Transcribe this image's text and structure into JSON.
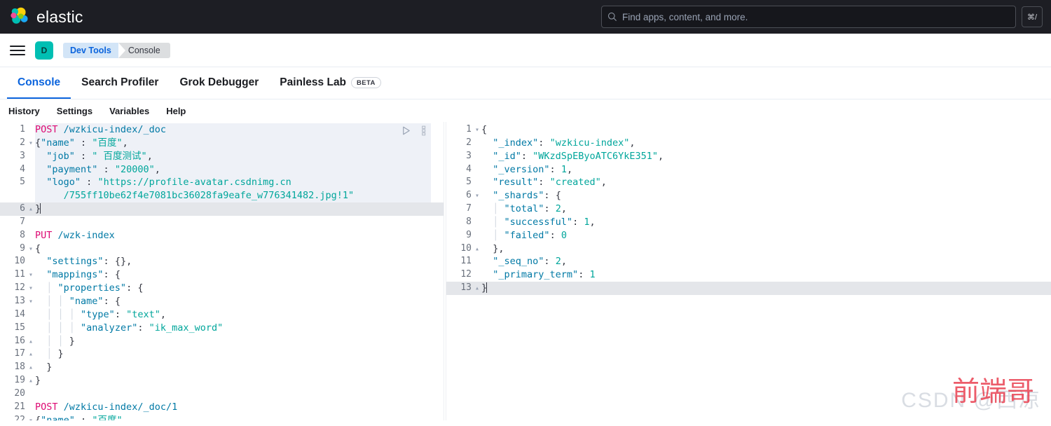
{
  "header": {
    "brand": "elastic",
    "logo_icon": "elastic-logo-icon",
    "search": {
      "placeholder": "Find apps, content, and more.",
      "icon": "search-icon",
      "shortcut": "⌘/"
    }
  },
  "breadcrumb": {
    "menu_icon": "hamburger-menu-icon",
    "space_initial": "D",
    "items": [
      {
        "label": "Dev Tools"
      },
      {
        "label": "Console"
      }
    ]
  },
  "app_tabs": [
    {
      "label": "Console",
      "active": true,
      "badge": ""
    },
    {
      "label": "Search Profiler",
      "active": false,
      "badge": ""
    },
    {
      "label": "Grok Debugger",
      "active": false,
      "badge": ""
    },
    {
      "label": "Painless Lab",
      "active": false,
      "badge": "BETA"
    }
  ],
  "console_submenu": [
    {
      "label": "History"
    },
    {
      "label": "Settings"
    },
    {
      "label": "Variables"
    },
    {
      "label": "Help"
    }
  ],
  "editor_actions": {
    "run_icon": "play-run-icon",
    "wrench_icon": "wrench-menu-icon"
  },
  "editor": {
    "lines": [
      {
        "n": "1",
        "fold": "",
        "tokens": [
          {
            "t": "POST",
            "c": "tk-method"
          },
          {
            "t": " ",
            "c": "tk-plain"
          },
          {
            "t": "/wzkicu-index/_doc",
            "c": "tk-url"
          }
        ]
      },
      {
        "n": "2",
        "fold": "▾",
        "tokens": [
          {
            "t": "{",
            "c": "tk-punct"
          },
          {
            "t": "\"name\"",
            "c": "tk-key"
          },
          {
            "t": " : ",
            "c": "tk-punct"
          },
          {
            "t": "\"百度\"",
            "c": "tk-string"
          },
          {
            "t": ",",
            "c": "tk-punct"
          }
        ]
      },
      {
        "n": "3",
        "fold": "",
        "tokens": [
          {
            "t": "  ",
            "c": "tk-plain"
          },
          {
            "t": "\"job\"",
            "c": "tk-key"
          },
          {
            "t": " : ",
            "c": "tk-punct"
          },
          {
            "t": "\" 百度测试\"",
            "c": "tk-string"
          },
          {
            "t": ",",
            "c": "tk-punct"
          }
        ]
      },
      {
        "n": "4",
        "fold": "",
        "tokens": [
          {
            "t": "  ",
            "c": "tk-plain"
          },
          {
            "t": "\"payment\"",
            "c": "tk-key"
          },
          {
            "t": " : ",
            "c": "tk-punct"
          },
          {
            "t": "\"20000\"",
            "c": "tk-string"
          },
          {
            "t": ",",
            "c": "tk-punct"
          }
        ]
      },
      {
        "n": "5",
        "fold": "",
        "tokens": [
          {
            "t": "  ",
            "c": "tk-plain"
          },
          {
            "t": "\"logo\"",
            "c": "tk-key"
          },
          {
            "t": " : ",
            "c": "tk-punct"
          },
          {
            "t": "\"https://profile-avatar.csdnimg.cn",
            "c": "tk-string"
          }
        ]
      },
      {
        "n": "",
        "fold": "",
        "tokens": [
          {
            "t": "     /755ff10be62f4e7081bc36028fa9eafe_w776341482.jpg!1\"",
            "c": "tk-string"
          }
        ]
      },
      {
        "n": "6",
        "fold": "▴",
        "caret": true,
        "tokens": [
          {
            "t": "}",
            "c": "tk-punct"
          }
        ]
      },
      {
        "n": "7",
        "fold": "",
        "tokens": []
      },
      {
        "n": "8",
        "fold": "",
        "tokens": [
          {
            "t": "PUT",
            "c": "tk-method"
          },
          {
            "t": " ",
            "c": "tk-plain"
          },
          {
            "t": "/wzk-index",
            "c": "tk-url"
          }
        ]
      },
      {
        "n": "9",
        "fold": "▾",
        "tokens": [
          {
            "t": "{",
            "c": "tk-punct"
          }
        ]
      },
      {
        "n": "10",
        "fold": "",
        "tokens": [
          {
            "t": "  ",
            "c": "tk-plain"
          },
          {
            "t": "\"settings\"",
            "c": "tk-key"
          },
          {
            "t": ": ",
            "c": "tk-punct"
          },
          {
            "t": "{},",
            "c": "tk-punct"
          }
        ]
      },
      {
        "n": "11",
        "fold": "▾",
        "tokens": [
          {
            "t": "  ",
            "c": "tk-plain"
          },
          {
            "t": "\"mappings\"",
            "c": "tk-key"
          },
          {
            "t": ": ",
            "c": "tk-punct"
          },
          {
            "t": "{",
            "c": "tk-punct"
          }
        ]
      },
      {
        "n": "12",
        "fold": "▾",
        "tokens": [
          {
            "t": "  ",
            "c": "tk-plain"
          },
          {
            "t": "│ ",
            "c": "tk-guide"
          },
          {
            "t": "\"properties\"",
            "c": "tk-key"
          },
          {
            "t": ": ",
            "c": "tk-punct"
          },
          {
            "t": "{",
            "c": "tk-punct"
          }
        ]
      },
      {
        "n": "13",
        "fold": "▾",
        "tokens": [
          {
            "t": "  ",
            "c": "tk-plain"
          },
          {
            "t": "│ │ ",
            "c": "tk-guide"
          },
          {
            "t": "\"name\"",
            "c": "tk-key"
          },
          {
            "t": ": ",
            "c": "tk-punct"
          },
          {
            "t": "{",
            "c": "tk-punct"
          }
        ]
      },
      {
        "n": "14",
        "fold": "",
        "tokens": [
          {
            "t": "  ",
            "c": "tk-plain"
          },
          {
            "t": "│ │ │ ",
            "c": "tk-guide"
          },
          {
            "t": "\"type\"",
            "c": "tk-key"
          },
          {
            "t": ": ",
            "c": "tk-punct"
          },
          {
            "t": "\"text\"",
            "c": "tk-string"
          },
          {
            "t": ",",
            "c": "tk-punct"
          }
        ]
      },
      {
        "n": "15",
        "fold": "",
        "tokens": [
          {
            "t": "  ",
            "c": "tk-plain"
          },
          {
            "t": "│ │ │ ",
            "c": "tk-guide"
          },
          {
            "t": "\"analyzer\"",
            "c": "tk-key"
          },
          {
            "t": ": ",
            "c": "tk-punct"
          },
          {
            "t": "\"ik_max_word\"",
            "c": "tk-string"
          }
        ]
      },
      {
        "n": "16",
        "fold": "▴",
        "tokens": [
          {
            "t": "  ",
            "c": "tk-plain"
          },
          {
            "t": "│ │ ",
            "c": "tk-guide"
          },
          {
            "t": "}",
            "c": "tk-punct"
          }
        ]
      },
      {
        "n": "17",
        "fold": "▴",
        "tokens": [
          {
            "t": "  ",
            "c": "tk-plain"
          },
          {
            "t": "│ ",
            "c": "tk-guide"
          },
          {
            "t": "}",
            "c": "tk-punct"
          }
        ]
      },
      {
        "n": "18",
        "fold": "▴",
        "tokens": [
          {
            "t": "  ",
            "c": "tk-plain"
          },
          {
            "t": "}",
            "c": "tk-punct"
          }
        ]
      },
      {
        "n": "19",
        "fold": "▴",
        "tokens": [
          {
            "t": "}",
            "c": "tk-punct"
          }
        ]
      },
      {
        "n": "20",
        "fold": "",
        "tokens": []
      },
      {
        "n": "21",
        "fold": "",
        "tokens": [
          {
            "t": "POST",
            "c": "tk-method"
          },
          {
            "t": " ",
            "c": "tk-plain"
          },
          {
            "t": "/wzkicu-index/_doc/1",
            "c": "tk-url"
          }
        ]
      },
      {
        "n": "22",
        "fold": "▾",
        "tokens": [
          {
            "t": "{",
            "c": "tk-punct"
          },
          {
            "t": "\"name\"",
            "c": "tk-key"
          },
          {
            "t": " : ",
            "c": "tk-punct"
          },
          {
            "t": "\"百度\"",
            "c": "tk-string"
          }
        ]
      }
    ]
  },
  "output": {
    "lines": [
      {
        "n": "1",
        "fold": "▾",
        "tokens": [
          {
            "t": "{",
            "c": "tk-punct"
          }
        ]
      },
      {
        "n": "2",
        "fold": "",
        "tokens": [
          {
            "t": "  ",
            "c": "tk-plain"
          },
          {
            "t": "\"_index\"",
            "c": "tk-key"
          },
          {
            "t": ": ",
            "c": "tk-punct"
          },
          {
            "t": "\"wzkicu-index\"",
            "c": "tk-string"
          },
          {
            "t": ",",
            "c": "tk-punct"
          }
        ]
      },
      {
        "n": "3",
        "fold": "",
        "tokens": [
          {
            "t": "  ",
            "c": "tk-plain"
          },
          {
            "t": "\"_id\"",
            "c": "tk-key"
          },
          {
            "t": ": ",
            "c": "tk-punct"
          },
          {
            "t": "\"WKzdSpEByoATC6YkE351\"",
            "c": "tk-string"
          },
          {
            "t": ",",
            "c": "tk-punct"
          }
        ]
      },
      {
        "n": "4",
        "fold": "",
        "tokens": [
          {
            "t": "  ",
            "c": "tk-plain"
          },
          {
            "t": "\"_version\"",
            "c": "tk-key"
          },
          {
            "t": ": ",
            "c": "tk-punct"
          },
          {
            "t": "1",
            "c": "tk-num"
          },
          {
            "t": ",",
            "c": "tk-punct"
          }
        ]
      },
      {
        "n": "5",
        "fold": "",
        "tokens": [
          {
            "t": "  ",
            "c": "tk-plain"
          },
          {
            "t": "\"result\"",
            "c": "tk-key"
          },
          {
            "t": ": ",
            "c": "tk-punct"
          },
          {
            "t": "\"created\"",
            "c": "tk-string"
          },
          {
            "t": ",",
            "c": "tk-punct"
          }
        ]
      },
      {
        "n": "6",
        "fold": "▾",
        "tokens": [
          {
            "t": "  ",
            "c": "tk-plain"
          },
          {
            "t": "\"_shards\"",
            "c": "tk-key"
          },
          {
            "t": ": ",
            "c": "tk-punct"
          },
          {
            "t": "{",
            "c": "tk-punct"
          }
        ]
      },
      {
        "n": "7",
        "fold": "",
        "tokens": [
          {
            "t": "  ",
            "c": "tk-plain"
          },
          {
            "t": "│ ",
            "c": "tk-guide"
          },
          {
            "t": "\"total\"",
            "c": "tk-key"
          },
          {
            "t": ": ",
            "c": "tk-punct"
          },
          {
            "t": "2",
            "c": "tk-num"
          },
          {
            "t": ",",
            "c": "tk-punct"
          }
        ]
      },
      {
        "n": "8",
        "fold": "",
        "tokens": [
          {
            "t": "  ",
            "c": "tk-plain"
          },
          {
            "t": "│ ",
            "c": "tk-guide"
          },
          {
            "t": "\"successful\"",
            "c": "tk-key"
          },
          {
            "t": ": ",
            "c": "tk-punct"
          },
          {
            "t": "1",
            "c": "tk-num"
          },
          {
            "t": ",",
            "c": "tk-punct"
          }
        ]
      },
      {
        "n": "9",
        "fold": "",
        "tokens": [
          {
            "t": "  ",
            "c": "tk-plain"
          },
          {
            "t": "│ ",
            "c": "tk-guide"
          },
          {
            "t": "\"failed\"",
            "c": "tk-key"
          },
          {
            "t": ": ",
            "c": "tk-punct"
          },
          {
            "t": "0",
            "c": "tk-num"
          }
        ]
      },
      {
        "n": "10",
        "fold": "▴",
        "tokens": [
          {
            "t": "  ",
            "c": "tk-plain"
          },
          {
            "t": "},",
            "c": "tk-punct"
          }
        ]
      },
      {
        "n": "11",
        "fold": "",
        "tokens": [
          {
            "t": "  ",
            "c": "tk-plain"
          },
          {
            "t": "\"_seq_no\"",
            "c": "tk-key"
          },
          {
            "t": ": ",
            "c": "tk-punct"
          },
          {
            "t": "2",
            "c": "tk-num"
          },
          {
            "t": ",",
            "c": "tk-punct"
          }
        ]
      },
      {
        "n": "12",
        "fold": "",
        "tokens": [
          {
            "t": "  ",
            "c": "tk-plain"
          },
          {
            "t": "\"_primary_term\"",
            "c": "tk-key"
          },
          {
            "t": ": ",
            "c": "tk-punct"
          },
          {
            "t": "1",
            "c": "tk-num"
          }
        ]
      },
      {
        "n": "13",
        "fold": "▴",
        "caret": true,
        "tokens": [
          {
            "t": "}",
            "c": "tk-punct"
          }
        ]
      }
    ]
  },
  "watermark": {
    "back_text": "CSDN @西凉",
    "front_text": "前端哥"
  }
}
